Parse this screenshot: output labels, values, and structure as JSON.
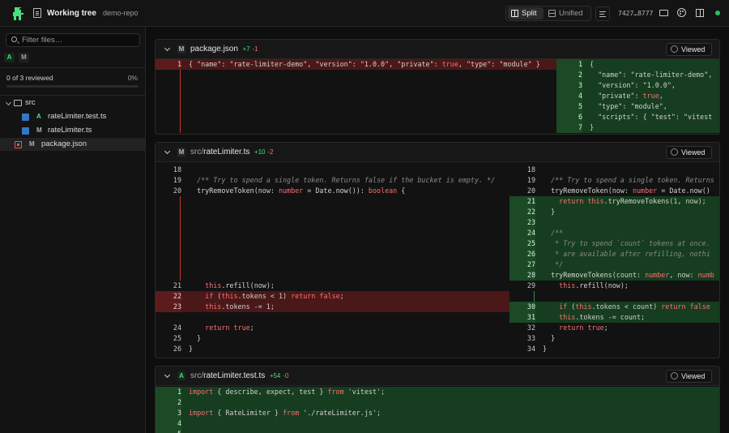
{
  "header": {
    "title": "Working tree",
    "repo": "demo-repo",
    "view_split": "Split",
    "view_unified": "Unified",
    "commit_range": "7427…8777"
  },
  "sidebar": {
    "filter_placeholder": "Filter files…",
    "status_chips": [
      "A",
      "M"
    ],
    "reviewed_text": "0 of 3 reviewed",
    "reviewed_percent": "0%",
    "reviewed_fraction": 0,
    "tree": [
      {
        "kind": "folder",
        "label": "src"
      },
      {
        "kind": "file",
        "status": "A",
        "label": "rateLimiter.test.ts"
      },
      {
        "kind": "file",
        "status": "M",
        "label": "rateLimiter.ts"
      },
      {
        "kind": "file",
        "status": "M",
        "label": "package.json"
      }
    ]
  },
  "files": [
    {
      "status": "M",
      "dir": "",
      "name": "package.json",
      "additions": "+7",
      "deletions": "-1",
      "viewed_label": "Viewed"
    },
    {
      "status": "M",
      "dir": "src/",
      "name": "rateLimiter.ts",
      "additions": "+10",
      "deletions": "-2",
      "viewed_label": "Viewed"
    },
    {
      "status": "A",
      "dir": "src/",
      "name": "rateLimiter.test.ts",
      "additions": "+54",
      "deletions": "-0",
      "viewed_label": "Viewed"
    }
  ],
  "colors": {
    "added": "#4ade80",
    "deleted": "#f87171",
    "status_ok": "#22c55e"
  }
}
